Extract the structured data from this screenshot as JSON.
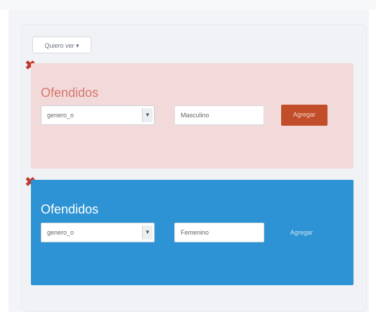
{
  "toolbar": {
    "view_button_label": "Quiero ver ▾"
  },
  "filters": [
    {
      "title": "Ofendidos",
      "select_value": "genero_o",
      "input_value": "Masculino",
      "add_label": "Agregar",
      "remove_symbol": "✖"
    },
    {
      "title": "Ofendidos",
      "select_value": "genero_o",
      "input_value": "Femenino",
      "add_label": "Agregar",
      "remove_symbol": "✖"
    }
  ],
  "colors": {
    "filter1_bg": "#f3dada",
    "filter2_bg": "#2d93d4",
    "accent_add": "#c14d2a",
    "remove": "#c0392b"
  },
  "icons": {
    "remove": "close-x-icon",
    "dropdown": "caret-down-icon"
  }
}
